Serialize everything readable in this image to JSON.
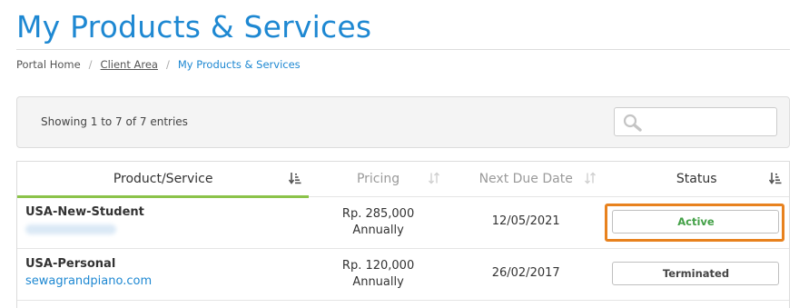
{
  "header": {
    "title": "My Products & Services"
  },
  "breadcrumb": {
    "items": [
      {
        "label": "Portal Home"
      },
      {
        "label": "Client Area"
      },
      {
        "label": "My Products & Services"
      }
    ],
    "separator": "/"
  },
  "filter": {
    "entries_info": "Showing 1 to 7 of 7 entries",
    "search_placeholder": "",
    "search_icon": "search-icon"
  },
  "table": {
    "columns": [
      {
        "label": "Product/Service",
        "sortable": true,
        "sorted": true
      },
      {
        "label": "Pricing",
        "sortable": true,
        "sorted": false
      },
      {
        "label": "Next Due Date",
        "sortable": true,
        "sorted": false
      },
      {
        "label": "Status",
        "sortable": true,
        "sorted": true
      }
    ],
    "rows": [
      {
        "product": "USA-New-Student",
        "domain": "",
        "price": "Rp. 285,000",
        "cycle": "Annually",
        "due": "12/05/2021",
        "status": "Active"
      },
      {
        "product": "USA-Personal",
        "domain": "sewagrandpiano.com",
        "price": "Rp. 120,000",
        "cycle": "Annually",
        "due": "26/02/2017",
        "status": "Terminated"
      }
    ]
  },
  "colors": {
    "accent": "#1e88d2",
    "sort_indicator": "#8bc34a",
    "active_status": "#43a047",
    "highlight": "#e8821e"
  }
}
